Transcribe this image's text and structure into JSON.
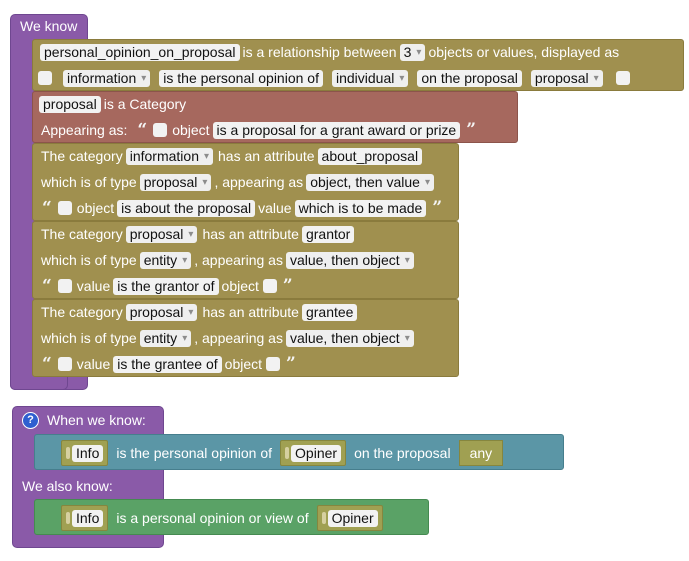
{
  "we_know": {
    "label": "We know"
  },
  "relationship": {
    "name": "personal_opinion_on_proposal",
    "text1": "is a relationship between",
    "count": "3",
    "text2": "objects or values, displayed as",
    "role1": "information",
    "phrase1": "is the personal opinion of",
    "role2": "individual",
    "phrase2": "on the proposal",
    "role3": "proposal"
  },
  "category": {
    "name": "proposal",
    "text": "is a Category",
    "appearing_as": "Appearing as:",
    "word": "object",
    "description": "is a proposal for a grant award or prize"
  },
  "attributes": [
    {
      "prefix": "The category",
      "category": "information",
      "has_attr": "has an attribute",
      "attribute": "about_proposal",
      "type_text": "which is of type",
      "type": "proposal",
      "appearing_text": ", appearing as",
      "order": "object, then value",
      "first_word": "object",
      "phrase": "is about the proposal",
      "second_word": "value",
      "tail": "which is to be made"
    },
    {
      "prefix": "The category",
      "category": "proposal",
      "has_attr": "has an attribute",
      "attribute": "grantor",
      "type_text": "which is of type",
      "type": "entity",
      "appearing_text": ", appearing as",
      "order": "value, then object",
      "first_word": "value",
      "phrase": "is the grantor of",
      "second_word": "object",
      "tail": ""
    },
    {
      "prefix": "The category",
      "category": "proposal",
      "has_attr": "has an attribute",
      "attribute": "grantee",
      "type_text": "which is of type",
      "type": "entity",
      "appearing_text": ", appearing as",
      "order": "value, then object",
      "first_word": "value",
      "phrase": "is the grantee of",
      "second_word": "object",
      "tail": ""
    }
  ],
  "rule": {
    "help": "?",
    "when_label": "When we know:",
    "when": {
      "var1": "Info",
      "text1": "is the personal opinion of",
      "var2": "Opiner",
      "text2": "on the proposal",
      "var3": "any"
    },
    "also_label": "We also know:",
    "also": {
      "var1": "Info",
      "text1": "is a personal opinion or view of",
      "var2": "Opiner"
    }
  },
  "colors": {
    "purple": "#8a5aa8",
    "tan": "#a0904f",
    "red": "#a6685e",
    "teal": "#5b96a6",
    "green": "#5aa266",
    "olive": "#a0a052"
  }
}
